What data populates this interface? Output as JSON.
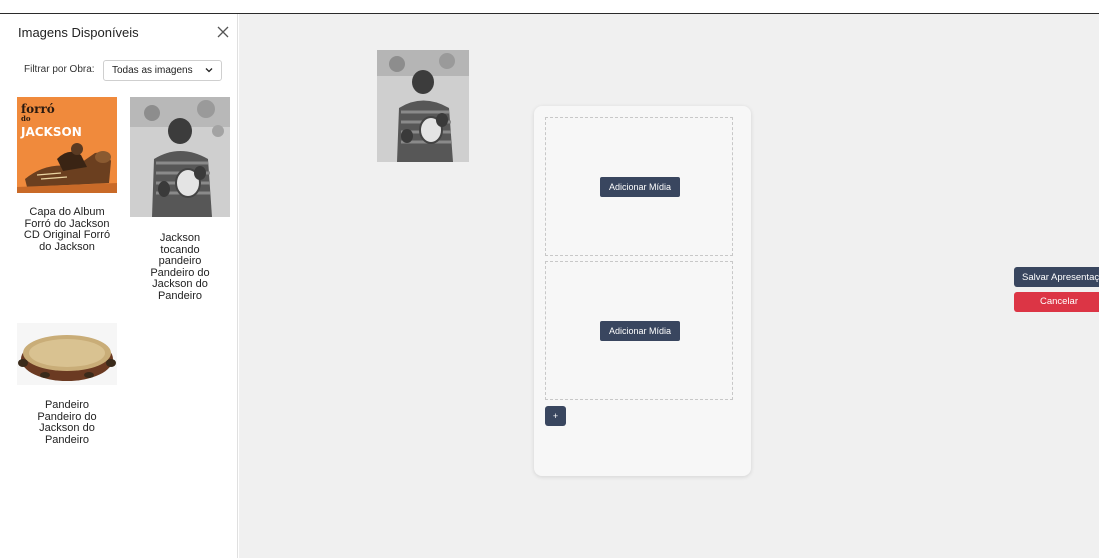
{
  "sidebar": {
    "title": "Imagens Disponíveis",
    "filter_label": "Filtrar por Obra:",
    "filter_selected": "Todas as imagens",
    "items": [
      {
        "caption": "Capa do Album Forró do Jackson CD Original Forró do Jackson",
        "cover_line1": "forró",
        "cover_line2": "do",
        "cover_line3": "JACKSON"
      },
      {
        "caption": "Jackson tocando pandeiro Pandeiro do Jackson do Pandeiro"
      },
      {
        "caption": "Pandeiro Pandeiro do Jackson do Pandeiro"
      }
    ]
  },
  "editor": {
    "slots": [
      {
        "button_label": "Adicionar Mídia"
      },
      {
        "button_label": "Adicionar Mídia"
      }
    ],
    "add_slot_label": "+"
  },
  "actions": {
    "save_label": "Salvar Apresentação",
    "cancel_label": "Cancelar"
  },
  "colors": {
    "primary": "#39465f",
    "danger": "#dc3545",
    "cover_orange": "#f08a3c",
    "canvas_bg": "#f0f0f0"
  }
}
